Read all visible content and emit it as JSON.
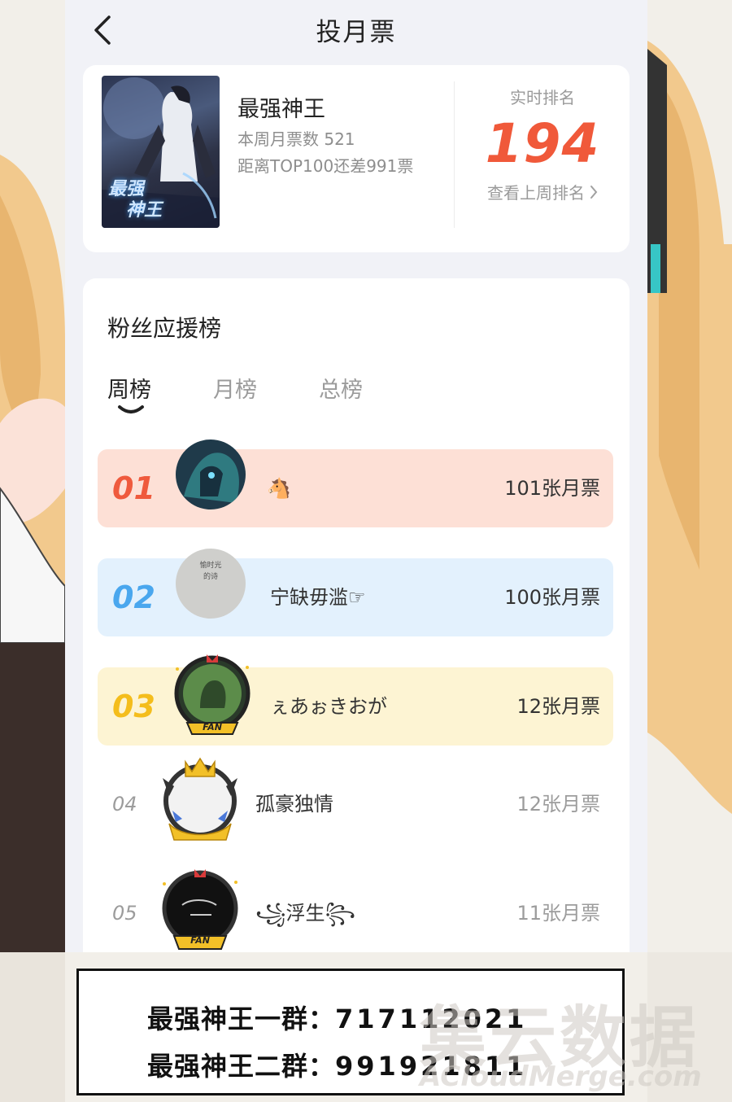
{
  "nav": {
    "title": "投月票",
    "back_icon": "chevron-left-icon"
  },
  "book": {
    "cover_text_line1": "最强",
    "cover_text_line2": "神王",
    "title": "最强神王",
    "weekly_votes": "本周月票数 521",
    "gap_to_top": "距离TOP100还差991票",
    "rank_label": "实时排名",
    "rank_value": "194",
    "last_week_link": "查看上周排名",
    "accent_color": "#f0593a"
  },
  "fan_board": {
    "heading": "粉丝应援榜",
    "tabs": [
      {
        "label": "周榜",
        "active": true
      },
      {
        "label": "月榜",
        "active": false
      },
      {
        "label": "总榜",
        "active": false
      }
    ],
    "rows": [
      {
        "rank": "01",
        "name": "🐴",
        "votes": "101张月票",
        "bg": "#fde0d6",
        "rank_color": "#ef5a3d"
      },
      {
        "rank": "02",
        "name": "宁缺毋滥☞",
        "votes": "100张月票",
        "bg": "#e3f1fd",
        "rank_color": "#4aa7ee"
      },
      {
        "rank": "03",
        "name": "ぇあぉきおが",
        "votes": "12张月票",
        "bg": "#fdf4d3",
        "rank_color": "#f4bd1c"
      },
      {
        "rank": "04",
        "name": "孤豪独情",
        "votes": "12张月票"
      },
      {
        "rank": "05",
        "name": "꧁浮生꧂",
        "votes": "11张月票"
      }
    ],
    "avatar2_text": "愉时光的诗",
    "fan_badge_text": "FAN"
  },
  "groups": [
    {
      "label": "最强神王一群：",
      "number": "717112021"
    },
    {
      "label": "最强神王二群：",
      "number": "991921811"
    }
  ],
  "watermark": {
    "cn": "集云数据",
    "en": "ACloudMerge.com"
  }
}
